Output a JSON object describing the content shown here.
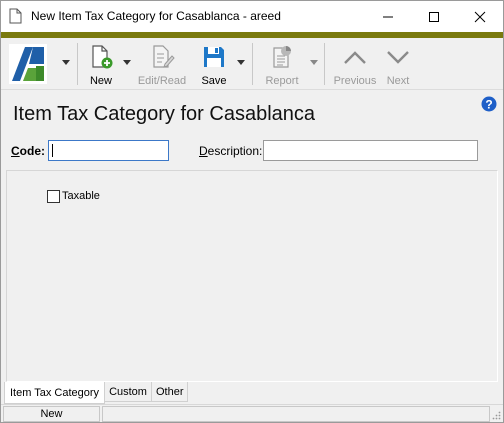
{
  "window": {
    "title": "New Item Tax Category for Casablanca - areed"
  },
  "toolbar": {
    "new_label": "New",
    "edit_read_label": "Edit/Read",
    "save_label": "Save",
    "report_label": "Report",
    "previous_label": "Previous",
    "next_label": "Next"
  },
  "form": {
    "heading": "Item Tax Category for Casablanca",
    "code_label_underlined": "C",
    "code_label_rest": "ode:",
    "code_value": "",
    "description_label_underlined": "D",
    "description_label_rest": "escription:",
    "description_value": "",
    "taxable_label": "Taxable",
    "taxable_checked": false
  },
  "tabs": [
    {
      "label": "Item Tax Category",
      "active": true
    },
    {
      "label": "Custom",
      "active": false
    },
    {
      "label": "Other",
      "active": false
    }
  ],
  "status": {
    "mode": "New"
  },
  "colors": {
    "accent_bar": "#7a7a0e",
    "logo_blue": "#1f5fa8",
    "logo_green": "#5aa33a",
    "save_blue": "#1e78c8",
    "help_blue": "#1e5fc8"
  },
  "icons": {
    "title": "document-icon",
    "minimize": "minimize-icon",
    "maximize": "maximize-icon",
    "close": "close-icon",
    "new": "new-document-icon",
    "edit_read": "edit-document-icon",
    "save": "floppy-disk-icon",
    "report": "report-icon",
    "previous": "chevron-up-icon",
    "next": "chevron-down-icon",
    "help": "help-icon"
  }
}
